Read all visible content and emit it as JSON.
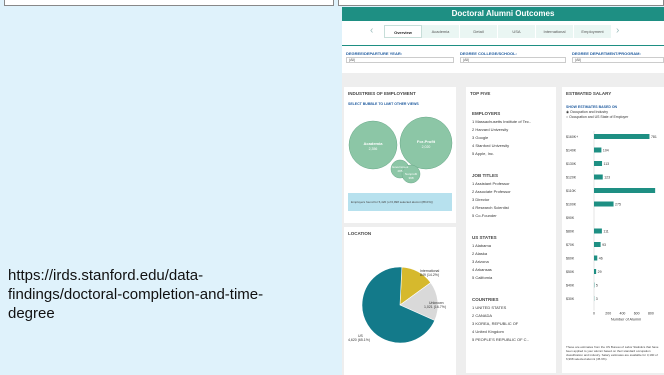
{
  "url_caption": "https://irds.stanford.edu/data-findings/doctoral-completion-and-time-degree",
  "dashboard": {
    "title": "Doctoral Alumni Outcomes",
    "tabs": [
      "Overview",
      "Academia",
      "Detail",
      "USA",
      "International",
      "Employment"
    ],
    "active_tab": 0,
    "filters": [
      {
        "label": "DEGREE/DEPARTURE YEAR:",
        "value": "(All)"
      },
      {
        "label": "DEGREE COLLEGE/SCHOOL:",
        "value": "(All)"
      },
      {
        "label": "DEGREE DEPARTMENT/PROGRAM:",
        "value": "(All)"
      }
    ]
  },
  "industries": {
    "header": "INDUSTRIES OF EMPLOYMENT",
    "hint": "SELECT BUBBLE TO LIMIT OTHER VIEWS",
    "bubbles": [
      {
        "name": "Academia",
        "value": "2,356"
      },
      {
        "name": "For-Profit",
        "value": "2,020"
      },
      {
        "name": "Government",
        "value": "285"
      },
      {
        "name": "Nonprofit",
        "value": "398"
      }
    ],
    "note": "Employers found for 5,420 (of 6,998 selected alumni (88.0%))"
  },
  "location": {
    "header": "LOCATION",
    "slices": [
      {
        "label": "International",
        "value": "849 (14.2%)",
        "pct": 14.2,
        "color": "#d6b92d"
      },
      {
        "label": "Unknown",
        "value": "1,021 (16.7%)",
        "pct": 16.7,
        "color": "#d9d9d9"
      },
      {
        "label": "US",
        "value": "4,620 (65.1%)",
        "pct": 69.1,
        "color": "#137a8a"
      }
    ]
  },
  "top_five": {
    "header": "TOP FIVE",
    "sections": [
      {
        "title": "EMPLOYERS",
        "items": [
          "Massachusetts Institute of Tec..",
          "Harvard University",
          "Google",
          "Stanford University",
          "Apple, Inc."
        ]
      },
      {
        "title": "JOB TITLES",
        "items": [
          "Assistant Professor",
          "Associate Professor",
          "Director",
          "Research Scientist",
          "Co-Founder"
        ]
      },
      {
        "title": "US STATES",
        "items": [
          "Alabama",
          "Alaska",
          "Arizona",
          "Arkansas",
          "California"
        ]
      },
      {
        "title": "COUNTRIES",
        "items": [
          "UNITED STATES",
          "CANADA",
          "KOREA, REPUBLIC OF",
          "United Kingdom",
          "PEOPLE'S REPUBLIC OF C.."
        ]
      }
    ]
  },
  "salary": {
    "header": "ESTIMATED SALARY",
    "subhead": "SHOW ESTIMATES BASED ON",
    "options": [
      "Occupation and Industry",
      "Occupation and US State of Employer"
    ],
    "selected_option": 0,
    "xlabel": "Number of Alumni",
    "xticks": [
      "0",
      "200",
      "400",
      "600",
      "800"
    ],
    "note": "These are estimates from the US Bureau of Labor Statistics that have been applied to your alumni based on their standard occupation classification and industry. Salary estimates are available for 3,190 of 6,998 selected alumni (45.6%)."
  },
  "chart_data": {
    "type": "bar",
    "orientation": "horizontal",
    "categories": [
      "$160K+",
      "$140K",
      "$130K",
      "$120K",
      "$110K",
      "$100K",
      "$90K",
      "$80K",
      "$70K",
      "$60K",
      "$50K",
      "$40K",
      "$30K"
    ],
    "values": [
      780,
      104,
      113,
      123,
      860,
      275,
      null,
      111,
      93,
      46,
      30,
      5,
      3
    ],
    "data_labels": [
      "781",
      "104",
      "113",
      "123",
      "",
      "275",
      "",
      "111",
      "93",
      "46",
      "29",
      "5",
      "3"
    ],
    "xlabel": "Number of Alumni",
    "xlim": [
      0,
      900
    ],
    "color": "#1e8f83"
  }
}
